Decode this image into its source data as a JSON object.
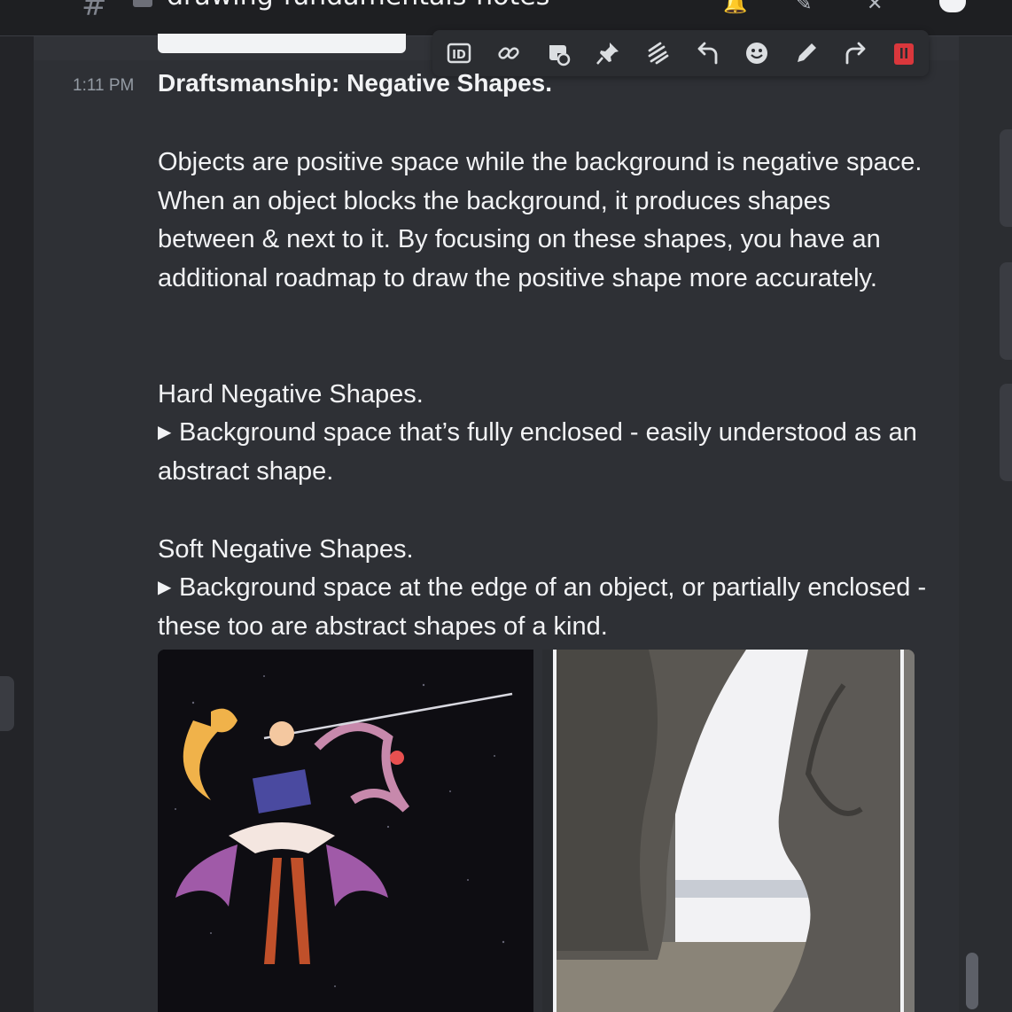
{
  "header": {
    "channel_name": "drawing-fundamentals-notes"
  },
  "message": {
    "timestamp": "1:11 PM",
    "title": "Draftsmanship: Negative Shapes.",
    "paragraphs": [
      "Objects are positive space while the background is negative space. When an object blocks the background, it produces shapes between & next to it. By focusing on these shapes, you have an additional roadmap to draw the positive shape more accurately."
    ],
    "hard_heading": "Hard Negative Shapes.",
    "hard_bullet": "Background space that’s fully enclosed - easily understood as an abstract shape.",
    "soft_heading": "Soft Negative Shapes.",
    "soft_bullet": "Background space at the edge of an object, or partially enclosed - these too are abstract shapes of a kind."
  },
  "toolbar": {
    "icons": [
      "id-icon",
      "link-icon",
      "thread-icon",
      "pin-icon",
      "more-icon",
      "reply-icon",
      "emoji-icon",
      "edit-icon",
      "forward-icon",
      "delete-icon"
    ]
  },
  "colors": {
    "background": "#313338",
    "delete_red": "#da373c"
  }
}
